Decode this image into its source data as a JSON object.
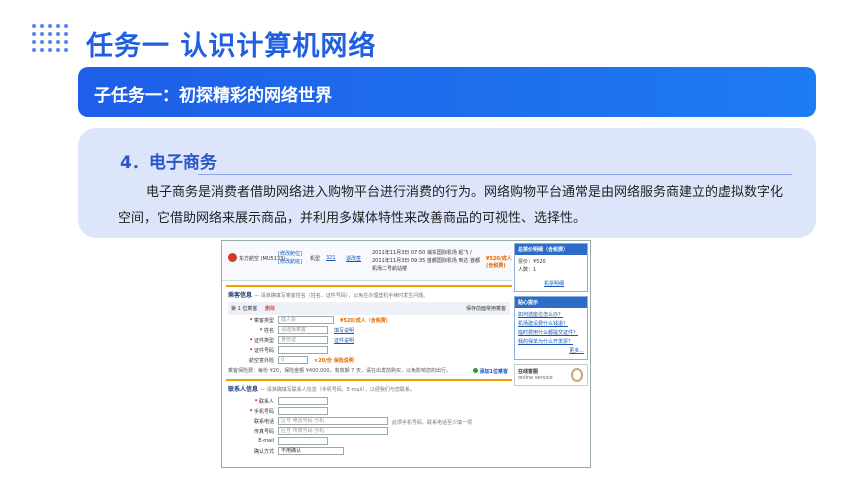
{
  "header": {
    "title": "任务一  认识计算机网络"
  },
  "subtask": {
    "label": "子任务一：初探精彩的网络世界"
  },
  "section": {
    "heading": "4．电子商务",
    "paragraph": "电子商务是消费者借助网络进入购物平台进行消费的行为。网络购物平台通常是由网络服务商建立的虚拟数字化空间，它借助网络来展示商品，并利用多媒体特性来改善商品的可视性、选择性。"
  },
  "screenshot": {
    "airline": "东方航空 (MU5133)",
    "links": [
      "[修改舱位]",
      "[修改航班]"
    ],
    "plane_label": "机型",
    "flight_code": "321",
    "change_label": "退改签",
    "route": "2011年11月3日 07:50  浦东国际机场 起飞 / 2011年11月3日 09:35  首都国际机场 到达  首都机场二号航站楼",
    "price": "¥520/成人 (含税费)",
    "sidebar": {
      "order_title": "总票价明细（含税费）",
      "order_lines": [
        "票价：¥520",
        "人数：1"
      ],
      "detail_link": "机票明细",
      "tips_title": "贴心提示",
      "tips": [
        "如何选座位怎么办？",
        "机场建设费什么钱退？",
        "临时费用什么都提交证件？",
        "我的保单为什么开发票？"
      ],
      "more": "更多...",
      "service_title": "在线客服",
      "service_sub": "online service"
    },
    "passenger": {
      "heading": "乘客信息",
      "heading_note": "— 请准确填写乘客姓名（姓名、证件号码），以免在办理登机手续时发生问题。",
      "index": "第 1 位乘客",
      "delete": "删除",
      "save": "保存前面常用乘客",
      "fields": [
        {
          "label": "乘客类型",
          "value": "成人票",
          "extra": "¥520/成人（含税费）"
        },
        {
          "label": "姓名",
          "value": "请选择乘客",
          "extra": "填写说明"
        },
        {
          "label": "证件类型",
          "value": "身份证",
          "extra": "证件说明"
        },
        {
          "label": "证件号码",
          "value": "",
          "extra": ""
        },
        {
          "label": "航空意外险",
          "value": "0",
          "extra": "×20/份 保险说明"
        }
      ],
      "note": "乘客保险费：每份 ¥20，保险金额 ¥400,000，有效期 7 天，请在出发前购买，以免影响您的出行。",
      "add": "添加1位乘客"
    },
    "contact": {
      "heading": "联系人信息",
      "heading_note": "— 请准确填写联系人信息（手机号码、E-mail），以便我们与您联系。",
      "fields": [
        {
          "label": "联系人",
          "value": ""
        },
        {
          "label": "手机号码",
          "value": ""
        },
        {
          "label": "联系电话",
          "value": "区号    电话号码    分机"
        },
        {
          "label": "传真号码",
          "value": "区号    传真号码    分机"
        },
        {
          "label": "E-mail",
          "value": ""
        },
        {
          "label": "确认方式",
          "value": "不用确认"
        }
      ],
      "hint": "此项手机号码、联系电话至少填一项"
    }
  }
}
